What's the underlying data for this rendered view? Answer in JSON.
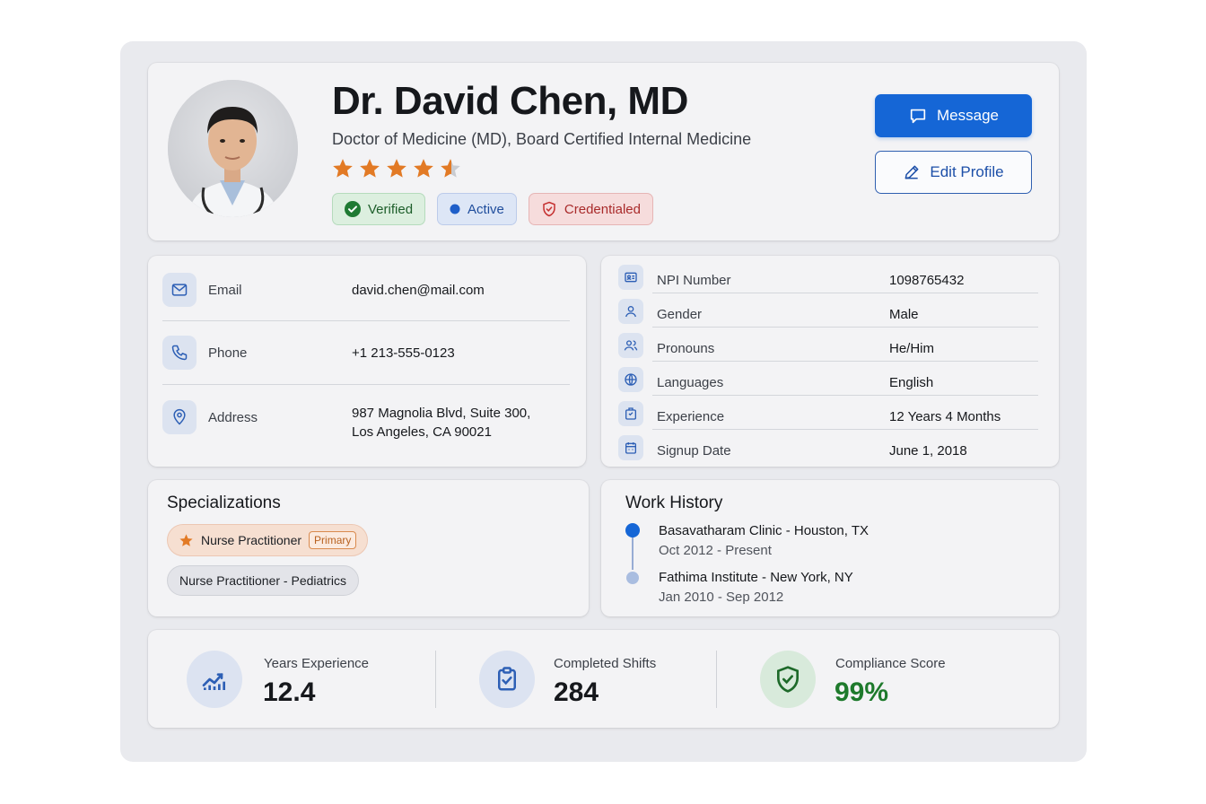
{
  "profile": {
    "name": "Dr. David Chen, MD",
    "subtitle": "Doctor of Medicine (MD), Board Certified Internal Medicine",
    "rating": 4.5,
    "badges": [
      {
        "label": "Verified",
        "icon": "check-circle-icon",
        "color": "#2e8a3e"
      },
      {
        "label": "Active",
        "icon": "dot-icon",
        "color": "#1f5fc9"
      },
      {
        "label": "Credentialed",
        "icon": "shield-check-icon",
        "color": "#c53030"
      }
    ]
  },
  "actions": {
    "message_label": "Message",
    "edit_label": "Edit Profile"
  },
  "contact": [
    {
      "label": "Email",
      "value": "david.chen@mail.com",
      "icon": "mail-icon"
    },
    {
      "label": "Phone",
      "value": "+1 213-555-0123",
      "icon": "phone-icon"
    },
    {
      "label": "Address",
      "value_line1": "987 Magnolia Blvd, Suite 300,",
      "value_line2": "Los Angeles, CA 90021",
      "icon": "map-pin-icon"
    }
  ],
  "details": [
    {
      "label": "NPI Number",
      "value": "1098765432",
      "icon": "id-card-icon"
    },
    {
      "label": "Gender",
      "value": "Male",
      "icon": "user-icon"
    },
    {
      "label": "Pronouns",
      "value": "He/Him",
      "icon": "users-icon"
    },
    {
      "label": "Languages",
      "value": "English",
      "icon": "globe-icon"
    },
    {
      "label": "Experience",
      "value": "12 Years 4 Months",
      "icon": "briefcase-icon"
    },
    {
      "label": "Signup Date",
      "value": "June 1, 2018",
      "icon": "calendar-icon"
    }
  ],
  "specializations": {
    "title": "Specializations",
    "items": [
      {
        "label": "Nurse Practitioner",
        "tag": "Primary",
        "icon": "star-icon"
      },
      {
        "label": "Nurse Practitioner - Pediatrics"
      }
    ]
  },
  "work_history": {
    "title": "Work History",
    "items": [
      {
        "title": "Basavatharam Clinic - Houston, TX",
        "dates": "Oct 2012 - Present"
      },
      {
        "title": "Fathima Institute - New York, NY",
        "dates": "Jan 2010 - Sep 2012"
      }
    ]
  },
  "stats": [
    {
      "label": "Years Experience",
      "value": "12.4",
      "icon": "trending-up-icon"
    },
    {
      "label": "Completed Shifts",
      "value": "284",
      "icon": "clipboard-check-icon"
    },
    {
      "label": "Compliance Score",
      "value": "99%",
      "icon": "shield-check-icon",
      "color": "#1e7a2c"
    }
  ],
  "colors": {
    "accent": "#1566d6",
    "star": "#e27a25",
    "success": "#1e7a2c"
  }
}
